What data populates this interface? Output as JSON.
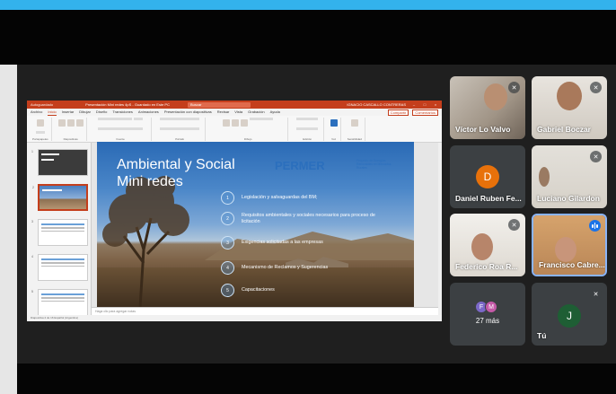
{
  "ppt": {
    "title_bar": {
      "autosave": "Autoguardado",
      "doc_name": "Presentación Mini redes 4pS - Guardado en Este PC",
      "search": "Buscar",
      "user": "IGNACIO CASCALLO CONTRERAS"
    },
    "menu": [
      "Archivo",
      "Inicio",
      "Insertar",
      "Dibujar",
      "Diseño",
      "Transiciones",
      "Animaciones",
      "Presentación con diapositivas",
      "Revisar",
      "Vista",
      "Grabación",
      "Ayuda"
    ],
    "share_label": "Compartir",
    "comments_label": "Comentarios",
    "ribbon_groups": [
      "Portapapeles",
      "Diapositivas",
      "Fuente",
      "Párrafo",
      "Dibujo",
      "Edición",
      "Voz",
      "Sensibilidad"
    ],
    "notes_placeholder": "Haga clic para agregar notas",
    "status_text": "Diapositiva 2 de 16   Español (Argentina)",
    "thumbnails": [
      {
        "num": "1",
        "style": "dark"
      },
      {
        "num": "2",
        "style": "photo"
      },
      {
        "num": "3",
        "style": "light"
      },
      {
        "num": "4",
        "style": "light"
      },
      {
        "num": "5",
        "style": "light"
      },
      {
        "num": "6",
        "style": "light"
      }
    ]
  },
  "slide": {
    "title_line1": "Ambiental y Social",
    "title_line2": "Mini redes",
    "brand": "PERMER",
    "brand_sub": "Proyecto de Energías Renovables en Mercados Rurales",
    "bullets": [
      {
        "num": "1",
        "text": "Legislación y salvaguardas del BM;"
      },
      {
        "num": "2",
        "text": "Requisitos ambientales y sociales necesarios para proceso de licitación"
      },
      {
        "num": "3",
        "text": "Exigencias solicitadas a las empresas"
      },
      {
        "num": "4",
        "text": "Mecanismo de Reclamos y Sugerencias"
      },
      {
        "num": "5",
        "text": "Capacitaciones"
      }
    ]
  },
  "participants": [
    {
      "name": "Víctor Lo Valvo",
      "muted": true
    },
    {
      "name": "Gabriel Boczar",
      "muted": true
    },
    {
      "name": "Daniel Ruben Fe...",
      "muted": false,
      "avatar_letter": "D",
      "avatar_color": "#e8710a"
    },
    {
      "name": "Luciano Gilardon",
      "muted": true
    },
    {
      "name": "Federico Roa R...",
      "muted": true
    },
    {
      "name": "Francisco Cabre...",
      "muted": false,
      "speaking": true
    },
    {
      "name": "27 más",
      "avatars": [
        {
          "letter": "F",
          "color": "#7b68c8"
        },
        {
          "letter": "M",
          "color": "#c55aa8"
        }
      ]
    },
    {
      "name": "Tú",
      "muted": true,
      "avatar_letter": "J",
      "avatar_color": "#1e5e34"
    }
  ],
  "colors": {
    "accent_bar": "#33b2ec",
    "ppt_accent": "#c43e1c",
    "speaking_border": "#8ab4f8"
  }
}
